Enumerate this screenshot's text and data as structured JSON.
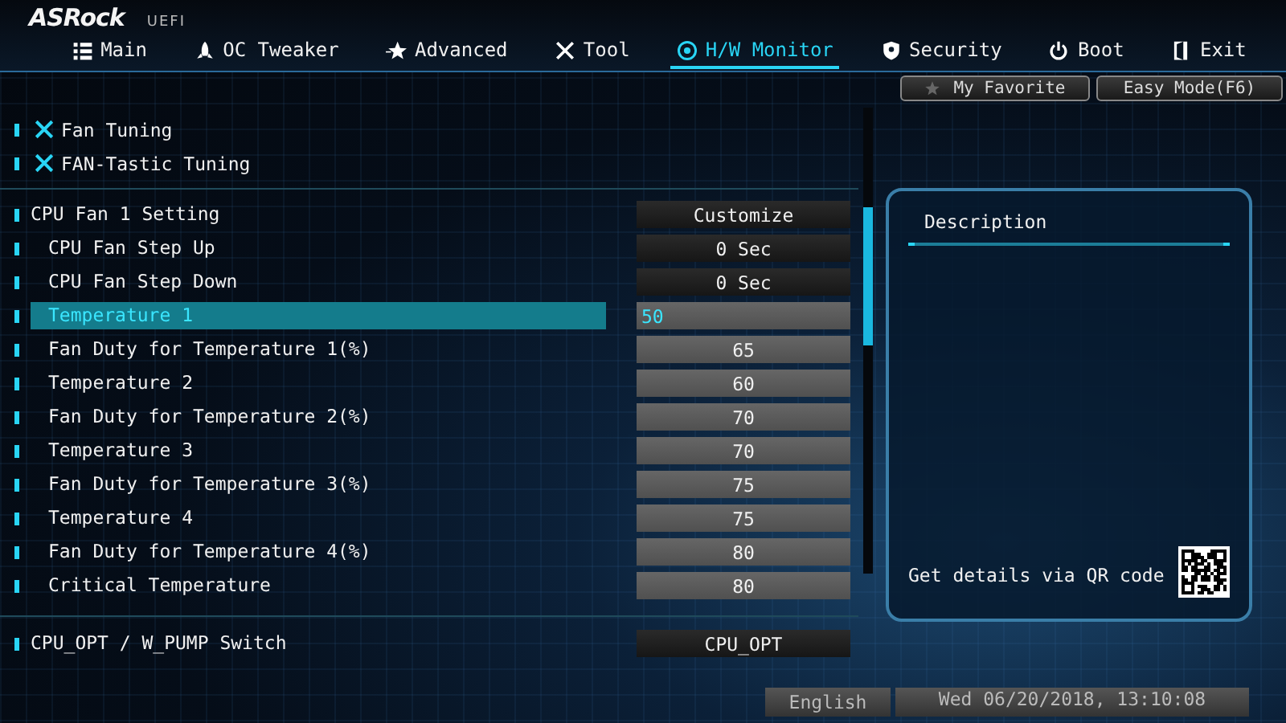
{
  "header": {
    "logo": "ASRock",
    "subtitle": "UEFI"
  },
  "tabs": [
    {
      "label": "Main",
      "selected": false
    },
    {
      "label": "OC Tweaker",
      "selected": false
    },
    {
      "label": "Advanced",
      "selected": false
    },
    {
      "label": "Tool",
      "selected": false
    },
    {
      "label": "H/W Monitor",
      "selected": true
    },
    {
      "label": "Security",
      "selected": false
    },
    {
      "label": "Boot",
      "selected": false
    },
    {
      "label": "Exit",
      "selected": false
    }
  ],
  "toolbar": {
    "favorite": "My Favorite",
    "easy_mode": "Easy Mode(F6)"
  },
  "links": [
    {
      "label": "Fan Tuning"
    },
    {
      "label": "FAN-Tastic Tuning"
    }
  ],
  "settings": [
    {
      "label": "CPU Fan 1 Setting",
      "value": "Customize",
      "kind": "option",
      "selected": false,
      "children": [
        {
          "label": "CPU Fan Step Up",
          "value": "0 Sec",
          "kind": "option",
          "selected": false
        },
        {
          "label": "CPU Fan Step Down",
          "value": "0 Sec",
          "kind": "option",
          "selected": false
        },
        {
          "label": "Temperature 1",
          "value": "50",
          "kind": "number",
          "selected": true
        },
        {
          "label": "Fan Duty for Temperature 1(%)",
          "value": "65",
          "kind": "number",
          "selected": false
        },
        {
          "label": "Temperature 2",
          "value": "60",
          "kind": "number",
          "selected": false
        },
        {
          "label": "Fan Duty for Temperature 2(%)",
          "value": "70",
          "kind": "number",
          "selected": false
        },
        {
          "label": "Temperature 3",
          "value": "70",
          "kind": "number",
          "selected": false
        },
        {
          "label": "Fan Duty for Temperature 3(%)",
          "value": "75",
          "kind": "number",
          "selected": false
        },
        {
          "label": "Temperature 4",
          "value": "75",
          "kind": "number",
          "selected": false
        },
        {
          "label": "Fan Duty for Temperature 4(%)",
          "value": "80",
          "kind": "number",
          "selected": false
        },
        {
          "label": "Critical Temperature",
          "value": "80",
          "kind": "number",
          "selected": false
        }
      ]
    },
    {
      "label": "CPU_OPT / W_PUMP Switch",
      "value": "CPU_OPT",
      "kind": "option",
      "selected": false
    }
  ],
  "description": {
    "title": "Description",
    "qr_hint": "Get details via QR code"
  },
  "status_bar": {
    "language": "English",
    "datetime": "Wed 06/20/2018, 13:10:08"
  }
}
